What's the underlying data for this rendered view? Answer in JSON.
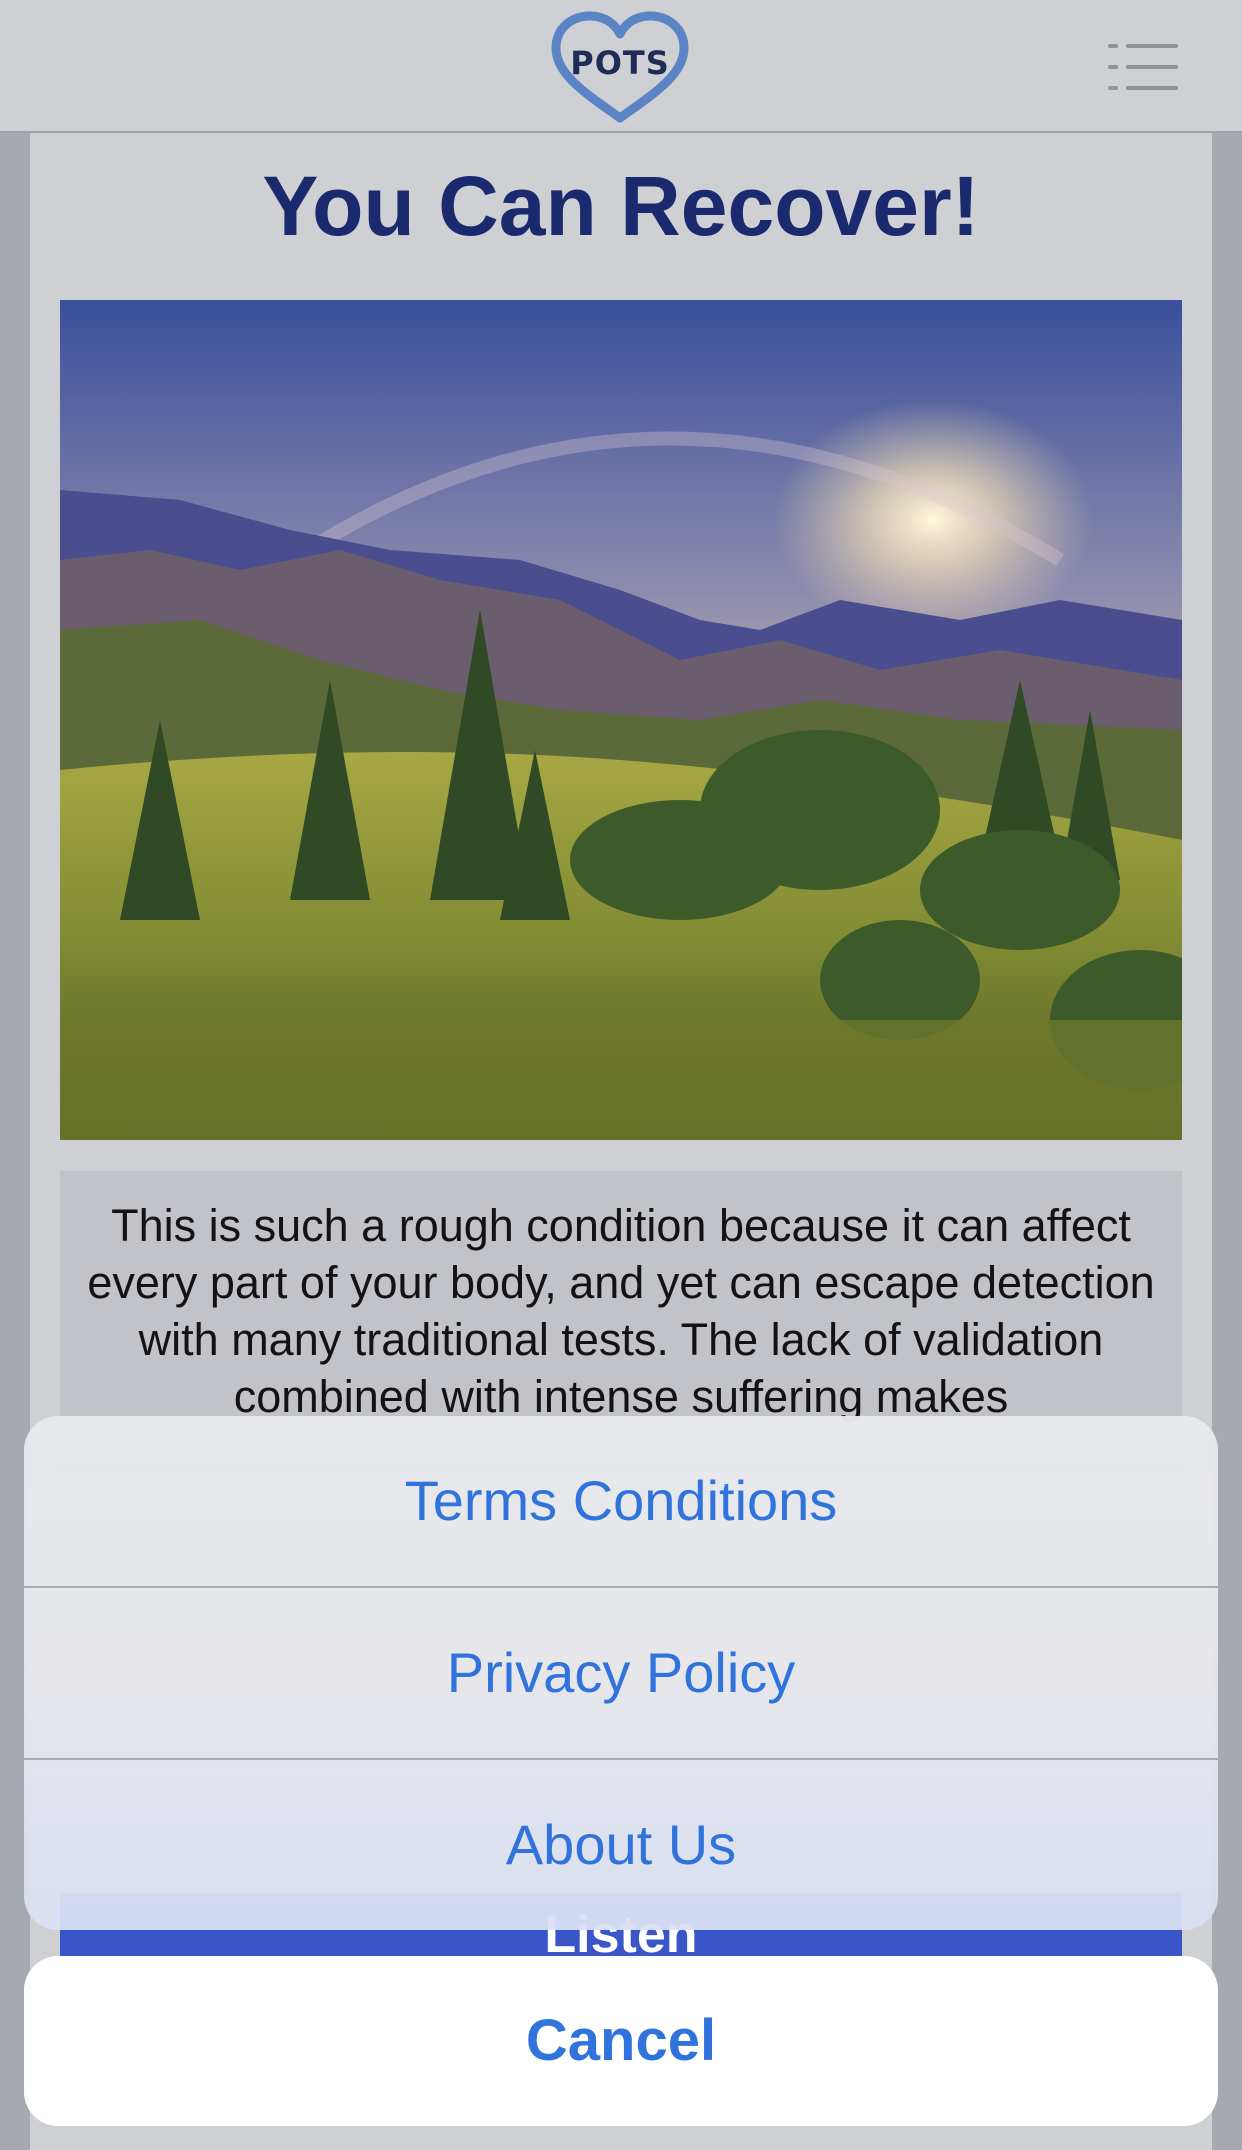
{
  "header": {
    "logo_text": "POTS",
    "menu_icon": "list-menu-icon"
  },
  "main": {
    "title": "You Can Recover!",
    "hero_image": "mountain-landscape-rainbow",
    "body_text": "This is such a rough condition because it can affect every part of your body, and yet can escape detection with many traditional tests. The lack of validation combined with intense suffering makes",
    "listen_label": "Listen"
  },
  "action_sheet": {
    "items": [
      "Terms Conditions",
      "Privacy Policy",
      "About Us"
    ],
    "cancel_label": "Cancel"
  },
  "colors": {
    "accent": "#3173dd",
    "title": "#1b2a6e",
    "listen_bar": "#3a55c8"
  }
}
